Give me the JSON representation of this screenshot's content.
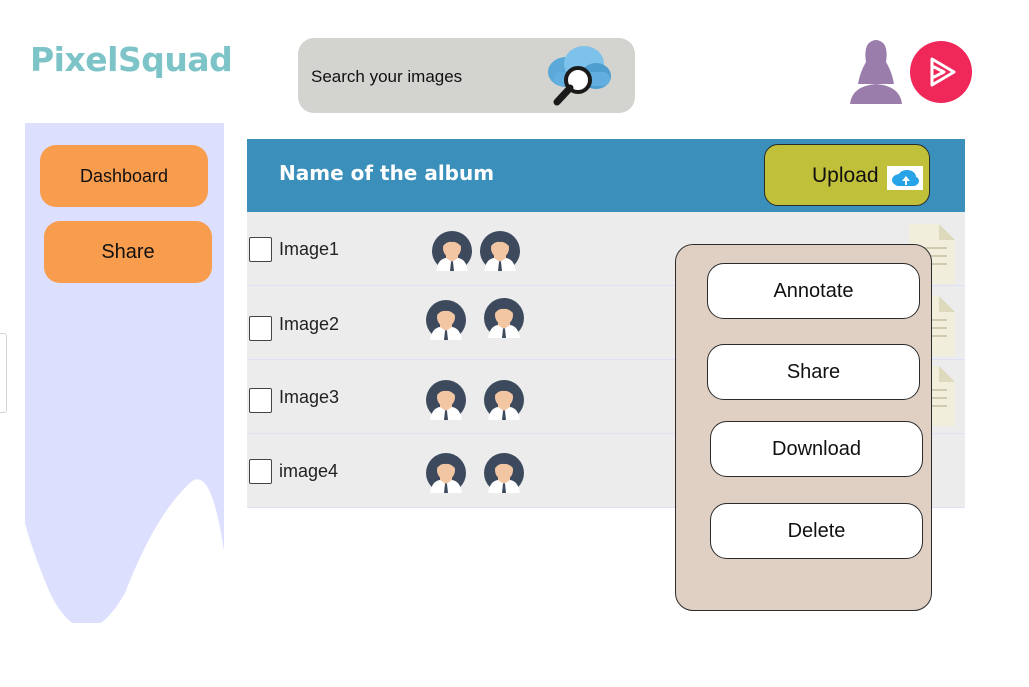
{
  "app": {
    "brand": "PixelSquad"
  },
  "search": {
    "text": "Search your images"
  },
  "sidebar": {
    "items": [
      {
        "label": "Dashboard"
      },
      {
        "label": "Share"
      }
    ]
  },
  "album": {
    "title": "Name of the album",
    "upload_label": "Upload"
  },
  "images": [
    {
      "name": "Image1"
    },
    {
      "name": "Image2"
    },
    {
      "name": "Image3"
    },
    {
      "name": "image4"
    }
  ],
  "context_menu": {
    "items": [
      {
        "label": "Annotate"
      },
      {
        "label": "Share"
      },
      {
        "label": "Download"
      },
      {
        "label": "Delete"
      }
    ]
  },
  "icons": {
    "search": "cloud-search-icon",
    "user": "user-silhouette-icon",
    "play": "play-circle-icon",
    "upload": "cloud-upload-icon",
    "avatar": "person-avatar-icon",
    "document": "document-icon"
  },
  "colors": {
    "brand": "#7cc4c8",
    "sidebar": "#dcdffd",
    "sidebar_button": "#f89c4e",
    "header": "#3b8fbb",
    "upload_button": "#c1c03b",
    "menu_background": "#e0d0c4",
    "play": "#f0285a",
    "user": "#9b7dac"
  }
}
